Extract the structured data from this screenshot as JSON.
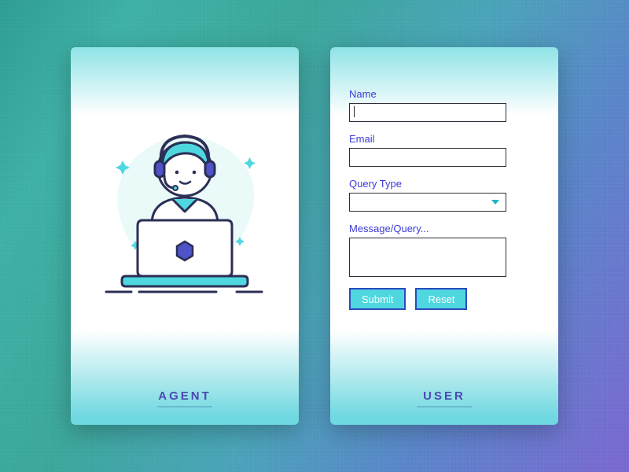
{
  "agent_card": {
    "title": "AGENT"
  },
  "user_card": {
    "title": "USER",
    "form": {
      "name_label": "Name",
      "name_value": "",
      "email_label": "Email",
      "email_value": "",
      "query_type_label": "Query Type",
      "query_type_value": "",
      "message_label": "Message/Query...",
      "message_value": "",
      "submit_label": "Submit",
      "reset_label": "Reset"
    }
  }
}
